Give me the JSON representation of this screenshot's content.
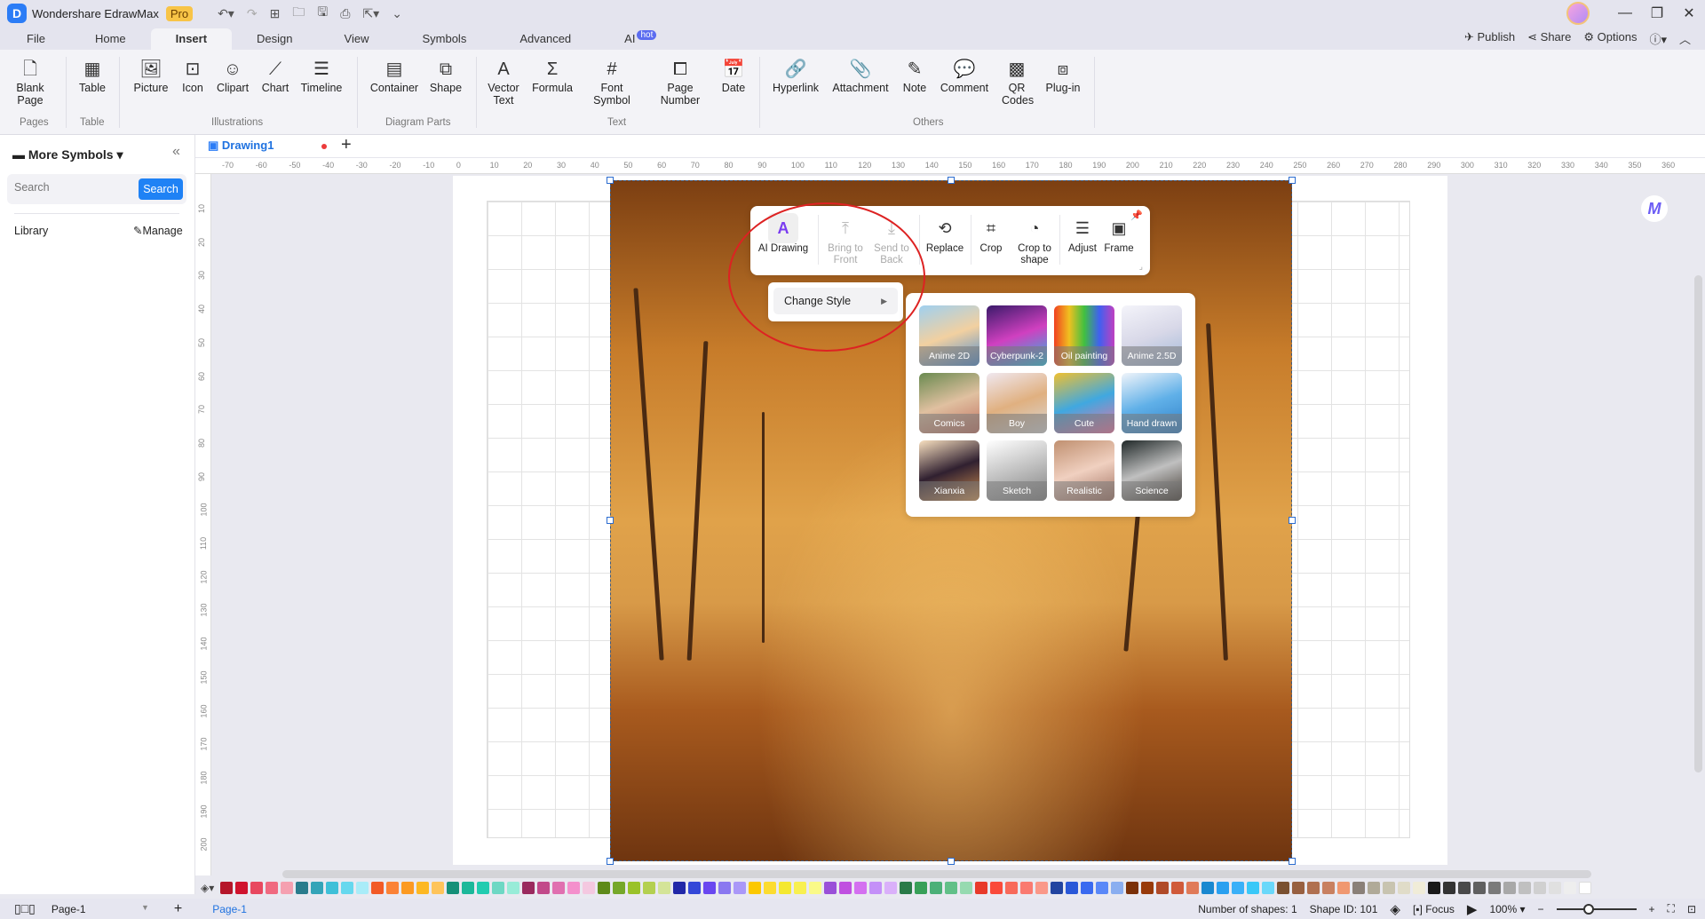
{
  "app": {
    "title": "Wondershare EdrawMax",
    "badge": "Pro"
  },
  "quick_access": [
    "undo-icon",
    "redo-icon",
    "new-icon",
    "open-icon",
    "save-icon",
    "print-icon",
    "export-icon",
    "customize-icon"
  ],
  "menu_tabs": [
    {
      "label": "File"
    },
    {
      "label": "Home"
    },
    {
      "label": "Insert",
      "active": true
    },
    {
      "label": "Design"
    },
    {
      "label": "View"
    },
    {
      "label": "Symbols"
    },
    {
      "label": "Advanced"
    },
    {
      "label": "AI",
      "badge": "hot"
    }
  ],
  "top_actions": {
    "publish": "Publish",
    "share": "Share",
    "options": "Options"
  },
  "ribbon": {
    "buttons": {
      "blank_page": "Blank Page",
      "table": "Table",
      "picture": "Picture",
      "icon": "Icon",
      "clipart": "Clipart",
      "chart": "Chart",
      "timeline": "Timeline",
      "container": "Container",
      "shape": "Shape",
      "vector_text": "Vector Text",
      "formula": "Formula",
      "font_symbol": "Font Symbol",
      "page_number": "Page Number",
      "date": "Date",
      "hyperlink": "Hyperlink",
      "attachment": "Attachment",
      "note": "Note",
      "comment": "Comment",
      "qr_codes": "QR Codes",
      "plugin": "Plug-in"
    },
    "groups": {
      "pages": "Pages",
      "table": "Table",
      "illustrations": "Illustrations",
      "diagram_parts": "Diagram Parts",
      "text": "Text",
      "others": "Others"
    }
  },
  "left_panel": {
    "title": "More Symbols",
    "search_placeholder": "Search",
    "search_button": "Search",
    "library": "Library",
    "manage": "Manage"
  },
  "document": {
    "tab": "Drawing1",
    "unsaved": true
  },
  "rulers": {
    "horizontal": [
      "-70",
      "-60",
      "-50",
      "-40",
      "-30",
      "-20",
      "-10",
      "0",
      "10",
      "20",
      "30",
      "40",
      "50",
      "60",
      "70",
      "80",
      "90",
      "100",
      "110",
      "120",
      "130",
      "140",
      "150",
      "160",
      "170",
      "180",
      "190",
      "200",
      "210",
      "220",
      "230",
      "240",
      "250",
      "260",
      "270",
      "280",
      "290",
      "300",
      "310",
      "320",
      "330",
      "340",
      "350",
      "360"
    ],
    "vertical": [
      "10",
      "20",
      "30",
      "40",
      "50",
      "60",
      "70",
      "80",
      "90",
      "100",
      "110",
      "120",
      "130",
      "140",
      "150",
      "160",
      "170",
      "180",
      "190",
      "200"
    ]
  },
  "image_toolbar": {
    "ai_drawing": "AI Drawing",
    "bring_to_front": "Bring to Front",
    "send_to_back": "Send to Back",
    "replace": "Replace",
    "crop": "Crop",
    "crop_to_shape": "Crop to shape",
    "adjust": "Adjust",
    "frame": "Frame"
  },
  "style_menu": {
    "change_style": "Change Style"
  },
  "styles": [
    "Anime 2D",
    "Cyberpunk-2",
    "Oil painting",
    "Anime 2.5D",
    "Comics",
    "Boy",
    "Cute",
    "Hand drawn",
    "Xianxia",
    "Sketch",
    "Realistic",
    "Science"
  ],
  "palette": [
    "#b5162a",
    "#d0142e",
    "#e8485f",
    "#f06a80",
    "#f5a0b0",
    "#2a7c8c",
    "#34a4b8",
    "#3fc0d8",
    "#66d8ee",
    "#a9ecf8",
    "#f25a26",
    "#fb8236",
    "#fc9a22",
    "#fdb822",
    "#fec45a",
    "#159078",
    "#1cb89a",
    "#22ccb0",
    "#6ed8c4",
    "#98ecd8",
    "#9a2a5e",
    "#c24a8a",
    "#e070b0",
    "#f490cc",
    "#f4c8e0",
    "#5e8a1a",
    "#76a82a",
    "#9ac22a",
    "#b4d050",
    "#d4e498",
    "#2228a8",
    "#3448d8",
    "#6a48f0",
    "#8a78f0",
    "#aa98f8",
    "#fcc800",
    "#fcdc30",
    "#f4e830",
    "#f8f050",
    "#fafa88",
    "#9a50d8",
    "#c050e0",
    "#d470f0",
    "#c490f8",
    "#dab0fa",
    "#2a7a48",
    "#38a058",
    "#4cb078",
    "#62c088",
    "#96dab0",
    "#e83a2a",
    "#fa4a3a",
    "#f86a5a",
    "#fa7a70",
    "#fa9888",
    "#2244a0",
    "#2a58d8",
    "#3a6af0",
    "#5a88f8",
    "#8aaef0",
    "#7a3008",
    "#983a0a",
    "#b04a28",
    "#d05a3a",
    "#e07a58",
    "#1a88d0",
    "#2aa0f0",
    "#3ab0f8",
    "#3ac8f8",
    "#6ad8fa",
    "#7a5030",
    "#986040",
    "#b07050",
    "#c88060",
    "#f09870",
    "#8a8078",
    "#b0aa98",
    "#c8c4b0",
    "#e0dcc8",
    "#f0ecd8",
    "#1a1a1a",
    "#333333",
    "#4a4a4a",
    "#606060",
    "#7a7a7a",
    "#a8a8a8",
    "#c0c0c0",
    "#d0d0d0",
    "#e0e0e0",
    "#eeeeee",
    "#ffffff"
  ],
  "status": {
    "page_selector": "Page-1",
    "page_tab": "Page-1",
    "shape_count": "Number of shapes: 1",
    "shape_id": "Shape ID: 101",
    "focus": "Focus",
    "zoom": "100%"
  }
}
